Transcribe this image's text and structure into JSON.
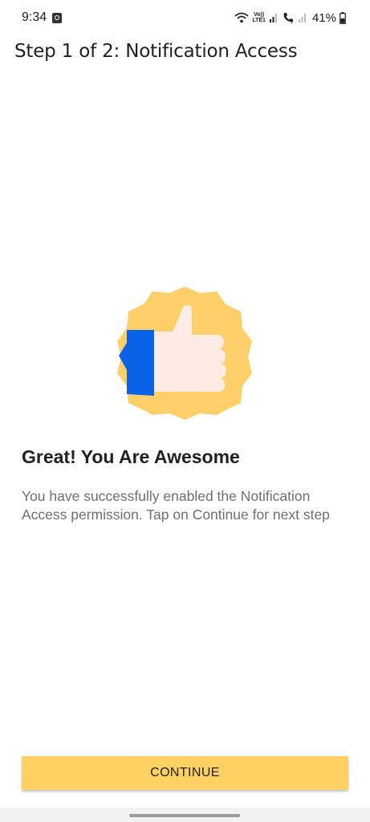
{
  "status_bar": {
    "time": "9:34",
    "lte_top": "Vo))",
    "lte_bottom": "LTE1",
    "battery": "41%",
    "icons": [
      "notification-app-icon",
      "wifi-icon",
      "signal-icon",
      "call-icon",
      "signal-icon",
      "battery-icon"
    ]
  },
  "header": {
    "title": "Step 1 of 2: Notification Access"
  },
  "hero": {
    "icon": "thumbs-up-badge-icon",
    "colors": {
      "badge": "#ffd06a",
      "hand": "#fdebe4",
      "cuff": "#0a63e6"
    }
  },
  "content": {
    "headline": "Great! You Are Awesome",
    "description": "You have successfully enabled the Notification Access permission. Tap on Continue for next step"
  },
  "actions": {
    "continue_label": "CONTINUE"
  },
  "theme": {
    "accent": "#ffd163",
    "text": "#202124",
    "muted_text": "#6f6f6f"
  }
}
